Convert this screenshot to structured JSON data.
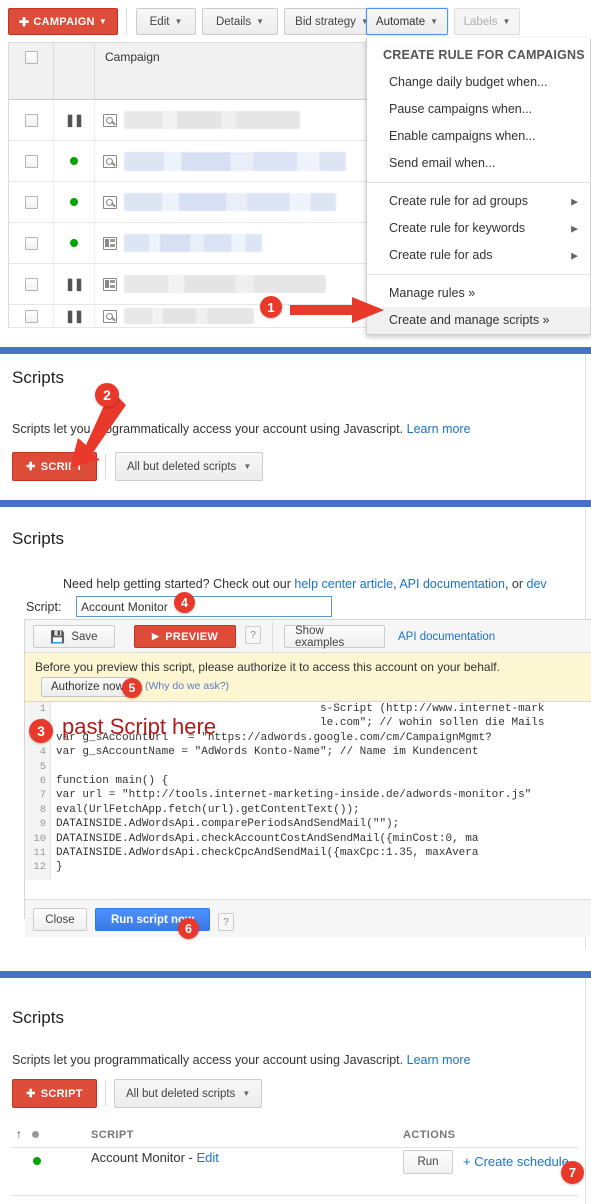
{
  "toolbar": {
    "campaign_button": "CAMPAIGN",
    "edit": "Edit",
    "details": "Details",
    "bid_strategy": "Bid strategy",
    "automate": "Automate",
    "labels": "Labels"
  },
  "table": {
    "column_header": "Campaign",
    "rows": [
      {
        "status": "paused",
        "type": "search"
      },
      {
        "status": "enabled",
        "type": "search"
      },
      {
        "status": "enabled",
        "type": "search"
      },
      {
        "status": "enabled",
        "type": "display"
      },
      {
        "status": "paused",
        "type": "display"
      },
      {
        "status": "paused",
        "type": "search"
      }
    ]
  },
  "menu": {
    "title": "CREATE RULE FOR CAMPAIGNS",
    "items": [
      {
        "label": "Change daily budget when...",
        "submenu": false
      },
      {
        "label": "Pause campaigns when...",
        "submenu": false
      },
      {
        "label": "Enable campaigns when...",
        "submenu": false
      },
      {
        "label": "Send email when...",
        "submenu": false
      }
    ],
    "items2": [
      {
        "label": "Create rule for ad groups",
        "submenu": true
      },
      {
        "label": "Create rule for keywords",
        "submenu": true
      },
      {
        "label": "Create rule for ads",
        "submenu": true
      }
    ],
    "items3": [
      {
        "label": "Manage rules »",
        "submenu": false
      },
      {
        "label": "Create and manage scripts »",
        "submenu": false
      }
    ]
  },
  "scripts_intro": {
    "heading": "Scripts",
    "description_before": "Scripts let you programmatically access your account using Javascript.",
    "learn_more": "Learn more",
    "script_button": "SCRIPT",
    "filter_label": "All but deleted scripts"
  },
  "editor": {
    "heading": "Scripts",
    "help_prefix": "Need help getting started? Check out our ",
    "help_link1": "help center article",
    "help_mid1": ", ",
    "help_link2": "API documentation",
    "help_mid2": ", or ",
    "help_link3": "dev",
    "script_label": "Script:",
    "script_name": "Account Monitor",
    "save": "Save",
    "preview": "PREVIEW",
    "help_hint": "?",
    "show_examples": "Show examples",
    "api_documentation": "API documentation",
    "warning": "Before you preview this script, please authorize it to access this account on your behalf.",
    "authorize_now": "Authorize now",
    "why_ask": "(Why do we ask?)",
    "close": "Close",
    "run_script_now": "Run script now",
    "line_numbers": [
      "1",
      "2",
      "3",
      "4",
      "5",
      "6",
      "7",
      "8",
      "9",
      "10",
      "11",
      "12"
    ],
    "code_lines": [
      "                                        s-Script (http://www.internet-mark",
      "                                        le.com\"; // wohin sollen die Mails",
      "var g_sAccountUrl   = \"https://adwords.google.com/cm/CampaignMgmt?",
      "var g_sAccountName = \"AdWords Konto-Name\"; // Name im Kundencent",
      "",
      "function main() {",
      "var url = \"http://tools.internet-marketing-inside.de/adwords-monitor.js\"",
      "eval(UrlFetchApp.fetch(url).getContentText());",
      "DATAINSIDE.AdWordsApi.comparePeriodsAndSendMail(\"\");",
      "DATAINSIDE.AdWordsApi.checkAccountCostAndSendMail({minCost:0, ma",
      "DATAINSIDE.AdWordsApi.checkCpcAndSendMail({maxCpc:1.35, maxAvera",
      "}"
    ]
  },
  "scripts_list": {
    "heading": "Scripts",
    "description_before": "Scripts let you programmatically access your account using Javascript.",
    "learn_more": "Learn more",
    "script_button": "SCRIPT",
    "filter_label": "All but deleted scripts",
    "col_script": "SCRIPT",
    "col_actions": "ACTIONS",
    "row": {
      "name": "Account Monitor - ",
      "edit": "Edit",
      "run": "Run",
      "create_schedule": "+ Create schedule"
    }
  },
  "annotations": {
    "b1": "1",
    "b2": "2",
    "b3": "3",
    "b4": "4",
    "b5": "5",
    "b6": "6",
    "b7": "7",
    "paste_text": "past Script here"
  }
}
